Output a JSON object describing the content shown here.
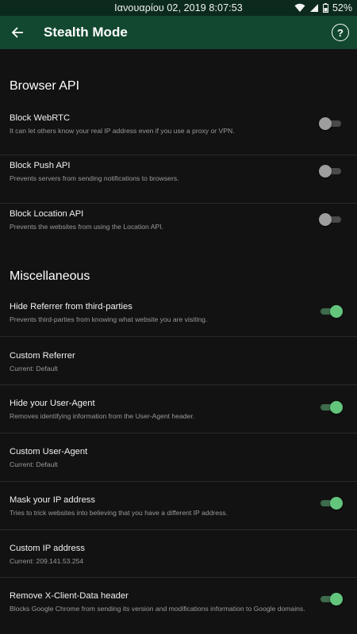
{
  "status_bar": {
    "datetime": "Ιανουαρίου 02, 2019 8:07:53",
    "battery": "52%"
  },
  "app_bar": {
    "title": "Stealth Mode",
    "help_glyph": "?"
  },
  "sections": {
    "browser_api": {
      "title": "Browser API",
      "items": [
        {
          "label": "Block WebRTC",
          "summary": "It can let others know your real IP address even if you use a proxy or VPN.",
          "switch_on": false
        },
        {
          "label": "Block Push API",
          "summary": "Prevents servers from sending notifications to browsers.",
          "switch_on": false
        },
        {
          "label": "Block Location API",
          "summary": "Prevents the websites from using the Location API.",
          "switch_on": false
        }
      ]
    },
    "misc": {
      "title": "Miscellaneous",
      "items": [
        {
          "label": "Hide Referrer from third-parties",
          "summary": "Prevents third-parties from knowing what website you are visiting.",
          "switch_on": true
        },
        {
          "label": "Custom Referrer",
          "summary": "Current: Default"
        },
        {
          "label": "Hide your User-Agent",
          "summary": "Removes identifying information from the User-Agent header.",
          "switch_on": true
        },
        {
          "label": "Custom User-Agent",
          "summary": "Current: Default"
        },
        {
          "label": "Mask your IP address",
          "summary": "Tries to trick websites into believing that you have a different IP address.",
          "switch_on": true
        },
        {
          "label": "Custom IP address",
          "summary": "Current: 209.141.53.254"
        },
        {
          "label": "Remove X-Client-Data header",
          "summary": "Blocks Google Chrome from sending its version and modifications information to Google domains.",
          "switch_on": true
        }
      ]
    }
  },
  "colors": {
    "status_bar_bg": "#0b2a1d",
    "app_bar_bg": "#12482f",
    "background": "#121212",
    "switch_on_thumb": "#63c57c",
    "switch_off_thumb": "#9e9e9e"
  }
}
